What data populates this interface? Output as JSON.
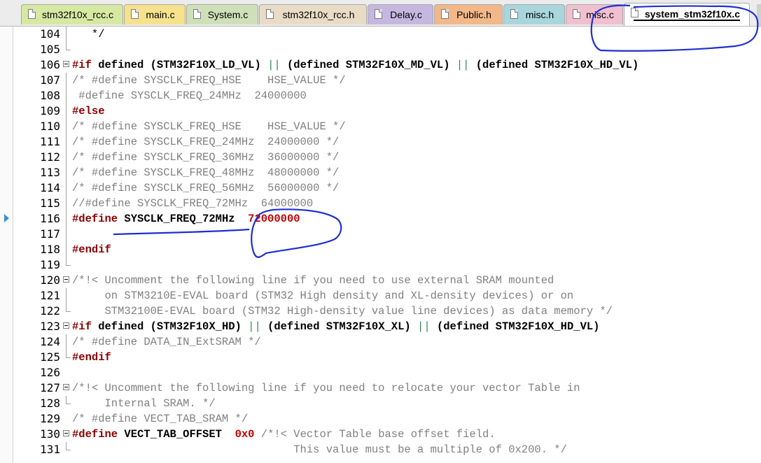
{
  "tabs": [
    {
      "label": "stm32f10x_rcc.c",
      "bg": "#d7e8a2"
    },
    {
      "label": "main.c",
      "bg": "#f6e28c"
    },
    {
      "label": "System.c",
      "bg": "#cfe0b8"
    },
    {
      "label": "stm32f10x_rcc.h",
      "bg": "#e9dcc6"
    },
    {
      "label": "Delay.c",
      "bg": "#c5b8e0"
    },
    {
      "label": "Public.h",
      "bg": "#f2b88a"
    },
    {
      "label": "misc.h",
      "bg": "#a8d6dc"
    },
    {
      "label": "misc.c",
      "bg": "#f0bfd0"
    },
    {
      "label": "system_stm32f10x.c",
      "bg": "#ffffff",
      "active": true
    }
  ],
  "lines": [
    {
      "n": "104",
      "text": "   */",
      "fold": "vline"
    },
    {
      "n": "105",
      "text": "",
      "fold": "vend"
    },
    {
      "n": "106",
      "fold": "box",
      "parts": [
        {
          "t": "#if",
          "c": "pp"
        },
        {
          "t": " defined ",
          "c": "kw"
        },
        {
          "t": "(STM32F10X_LD_VL)",
          "c": "par"
        },
        {
          "t": " || ",
          "c": "grn"
        },
        {
          "t": "(defined STM32F10X_MD_VL)",
          "c": "par"
        },
        {
          "t": " || ",
          "c": "grn"
        },
        {
          "t": "(defined STM32F10X_HD_VL)",
          "c": "par"
        }
      ]
    },
    {
      "n": "107",
      "text": "/* #define SYSCLK_FREQ_HSE    HSE_VALUE */",
      "cls": "cmt",
      "fold": "vline"
    },
    {
      "n": "108",
      "text": " #define SYSCLK_FREQ_24MHz  24000000",
      "cls": "cmt",
      "fold": "vline"
    },
    {
      "n": "109",
      "parts": [
        {
          "t": "#else",
          "c": "pp"
        }
      ],
      "fold": "vline"
    },
    {
      "n": "110",
      "text": "/* #define SYSCLK_FREQ_HSE    HSE_VALUE */",
      "cls": "cmt",
      "fold": "vline"
    },
    {
      "n": "111",
      "text": "/* #define SYSCLK_FREQ_24MHz  24000000 */",
      "cls": "cmt",
      "fold": "vline"
    },
    {
      "n": "112",
      "text": "/* #define SYSCLK_FREQ_36MHz  36000000 */",
      "cls": "cmt",
      "fold": "vline"
    },
    {
      "n": "113",
      "text": "/* #define SYSCLK_FREQ_48MHz  48000000 */",
      "cls": "cmt",
      "fold": "vline"
    },
    {
      "n": "114",
      "text": "/* #define SYSCLK_FREQ_56MHz  56000000 */",
      "cls": "cmt",
      "fold": "vline"
    },
    {
      "n": "115",
      "text": "//#define SYSCLK_FREQ_72MHz  64000000",
      "cls": "cmt",
      "fold": "vline"
    },
    {
      "n": "116",
      "parts": [
        {
          "t": "#define",
          "c": "pp"
        },
        {
          "t": " SYSCLK_FREQ_72MHz  ",
          "c": "kw"
        },
        {
          "t": "72000000",
          "c": "num"
        }
      ],
      "fold": "vline"
    },
    {
      "n": "117",
      "text": "",
      "fold": "vline"
    },
    {
      "n": "118",
      "parts": [
        {
          "t": "#endif",
          "c": "pp"
        }
      ],
      "fold": "vline"
    },
    {
      "n": "119",
      "text": "",
      "fold": "vend"
    },
    {
      "n": "120",
      "text": "/*!< Uncomment the following line if you need to use external SRAM mounted",
      "cls": "cmt",
      "fold": "box"
    },
    {
      "n": "121",
      "text": "     on STM3210E-EVAL board (STM32 High density and XL-density devices) or on",
      "cls": "cmt",
      "fold": "vline"
    },
    {
      "n": "122",
      "text": "     STM32100E-EVAL board (STM32 High-density value line devices) as data memory */",
      "cls": "cmt",
      "fold": "vend"
    },
    {
      "n": "123",
      "fold": "box",
      "parts": [
        {
          "t": "#if",
          "c": "pp"
        },
        {
          "t": " defined ",
          "c": "kw"
        },
        {
          "t": "(STM32F10X_HD)",
          "c": "par"
        },
        {
          "t": " || ",
          "c": "grn"
        },
        {
          "t": "(defined STM32F10X_XL)",
          "c": "par"
        },
        {
          "t": " || ",
          "c": "grn"
        },
        {
          "t": "(defined STM32F10X_HD_VL)",
          "c": "par"
        }
      ]
    },
    {
      "n": "124",
      "text": "/* #define DATA_IN_ExtSRAM */",
      "cls": "cmt",
      "fold": "vline"
    },
    {
      "n": "125",
      "parts": [
        {
          "t": "#endif",
          "c": "pp"
        }
      ],
      "fold": "vend"
    },
    {
      "n": "126",
      "text": "",
      "fold": "none"
    },
    {
      "n": "127",
      "text": "/*!< Uncomment the following line if you need to relocate your vector Table in",
      "cls": "cmt",
      "fold": "box"
    },
    {
      "n": "128",
      "text": "     Internal SRAM. */",
      "cls": "cmt",
      "fold": "vend"
    },
    {
      "n": "129",
      "text": "/* #define VECT_TAB_SRAM */",
      "cls": "cmt",
      "fold": "none"
    },
    {
      "n": "130",
      "fold": "box",
      "parts": [
        {
          "t": "#define",
          "c": "pp"
        },
        {
          "t": " VECT_TAB_OFFSET  ",
          "c": "kw"
        },
        {
          "t": "0x0",
          "c": "num"
        },
        {
          "t": " /*!< Vector Table base offset field.",
          "c": "cmt"
        }
      ]
    },
    {
      "n": "131",
      "text": "                                  This value must be a multiple of 0x200. */",
      "cls": "cmt",
      "fold": "vend"
    }
  ]
}
